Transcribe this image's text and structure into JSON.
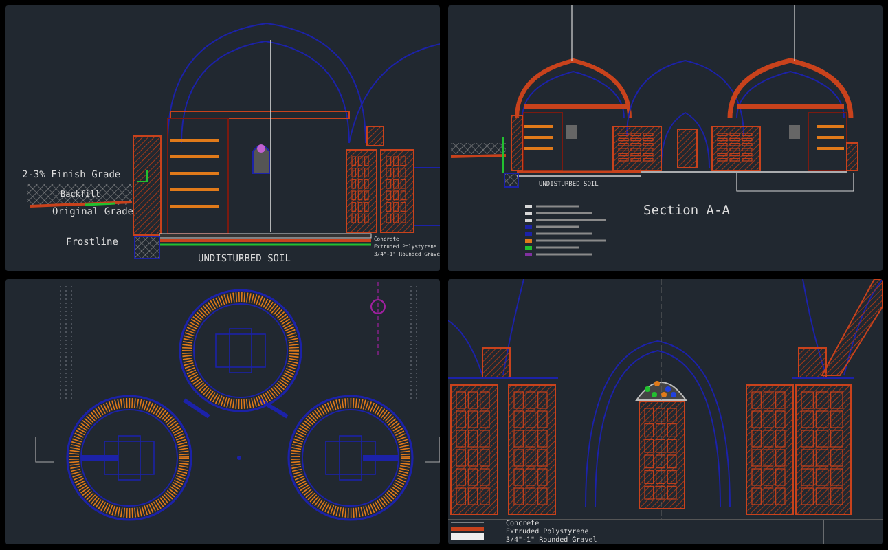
{
  "panels": [
    {
      "kind": "section-detail",
      "labels": [
        "2-3% Finish Grade",
        "Backfill",
        "Original Grade",
        "Frostline",
        "UNDISTURBED SOIL",
        "Concrete",
        "Extruded Polystyrene",
        "3/4\"-1\" Rounded Grave"
      ]
    },
    {
      "kind": "section",
      "labels": [
        "UNDISTURBED SOIL",
        "Section A-A"
      ]
    },
    {
      "kind": "plan"
    },
    {
      "kind": "elevation",
      "labels": [
        "Concrete",
        "Extruded Polystyrene",
        "3/4\"-1\" Rounded Gravel"
      ]
    }
  ]
}
